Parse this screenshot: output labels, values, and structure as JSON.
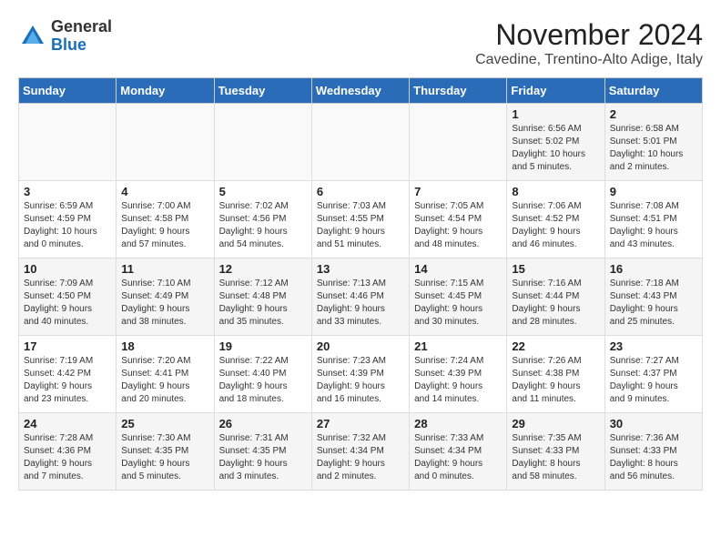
{
  "header": {
    "logo": {
      "general": "General",
      "blue": "Blue"
    },
    "title": "November 2024",
    "location": "Cavedine, Trentino-Alto Adige, Italy"
  },
  "weekdays": [
    "Sunday",
    "Monday",
    "Tuesday",
    "Wednesday",
    "Thursday",
    "Friday",
    "Saturday"
  ],
  "weeks": [
    [
      {
        "day": "",
        "info": ""
      },
      {
        "day": "",
        "info": ""
      },
      {
        "day": "",
        "info": ""
      },
      {
        "day": "",
        "info": ""
      },
      {
        "day": "",
        "info": ""
      },
      {
        "day": "1",
        "info": "Sunrise: 6:56 AM\nSunset: 5:02 PM\nDaylight: 10 hours\nand 5 minutes."
      },
      {
        "day": "2",
        "info": "Sunrise: 6:58 AM\nSunset: 5:01 PM\nDaylight: 10 hours\nand 2 minutes."
      }
    ],
    [
      {
        "day": "3",
        "info": "Sunrise: 6:59 AM\nSunset: 4:59 PM\nDaylight: 10 hours\nand 0 minutes."
      },
      {
        "day": "4",
        "info": "Sunrise: 7:00 AM\nSunset: 4:58 PM\nDaylight: 9 hours\nand 57 minutes."
      },
      {
        "day": "5",
        "info": "Sunrise: 7:02 AM\nSunset: 4:56 PM\nDaylight: 9 hours\nand 54 minutes."
      },
      {
        "day": "6",
        "info": "Sunrise: 7:03 AM\nSunset: 4:55 PM\nDaylight: 9 hours\nand 51 minutes."
      },
      {
        "day": "7",
        "info": "Sunrise: 7:05 AM\nSunset: 4:54 PM\nDaylight: 9 hours\nand 48 minutes."
      },
      {
        "day": "8",
        "info": "Sunrise: 7:06 AM\nSunset: 4:52 PM\nDaylight: 9 hours\nand 46 minutes."
      },
      {
        "day": "9",
        "info": "Sunrise: 7:08 AM\nSunset: 4:51 PM\nDaylight: 9 hours\nand 43 minutes."
      }
    ],
    [
      {
        "day": "10",
        "info": "Sunrise: 7:09 AM\nSunset: 4:50 PM\nDaylight: 9 hours\nand 40 minutes."
      },
      {
        "day": "11",
        "info": "Sunrise: 7:10 AM\nSunset: 4:49 PM\nDaylight: 9 hours\nand 38 minutes."
      },
      {
        "day": "12",
        "info": "Sunrise: 7:12 AM\nSunset: 4:48 PM\nDaylight: 9 hours\nand 35 minutes."
      },
      {
        "day": "13",
        "info": "Sunrise: 7:13 AM\nSunset: 4:46 PM\nDaylight: 9 hours\nand 33 minutes."
      },
      {
        "day": "14",
        "info": "Sunrise: 7:15 AM\nSunset: 4:45 PM\nDaylight: 9 hours\nand 30 minutes."
      },
      {
        "day": "15",
        "info": "Sunrise: 7:16 AM\nSunset: 4:44 PM\nDaylight: 9 hours\nand 28 minutes."
      },
      {
        "day": "16",
        "info": "Sunrise: 7:18 AM\nSunset: 4:43 PM\nDaylight: 9 hours\nand 25 minutes."
      }
    ],
    [
      {
        "day": "17",
        "info": "Sunrise: 7:19 AM\nSunset: 4:42 PM\nDaylight: 9 hours\nand 23 minutes."
      },
      {
        "day": "18",
        "info": "Sunrise: 7:20 AM\nSunset: 4:41 PM\nDaylight: 9 hours\nand 20 minutes."
      },
      {
        "day": "19",
        "info": "Sunrise: 7:22 AM\nSunset: 4:40 PM\nDaylight: 9 hours\nand 18 minutes."
      },
      {
        "day": "20",
        "info": "Sunrise: 7:23 AM\nSunset: 4:39 PM\nDaylight: 9 hours\nand 16 minutes."
      },
      {
        "day": "21",
        "info": "Sunrise: 7:24 AM\nSunset: 4:39 PM\nDaylight: 9 hours\nand 14 minutes."
      },
      {
        "day": "22",
        "info": "Sunrise: 7:26 AM\nSunset: 4:38 PM\nDaylight: 9 hours\nand 11 minutes."
      },
      {
        "day": "23",
        "info": "Sunrise: 7:27 AM\nSunset: 4:37 PM\nDaylight: 9 hours\nand 9 minutes."
      }
    ],
    [
      {
        "day": "24",
        "info": "Sunrise: 7:28 AM\nSunset: 4:36 PM\nDaylight: 9 hours\nand 7 minutes."
      },
      {
        "day": "25",
        "info": "Sunrise: 7:30 AM\nSunset: 4:35 PM\nDaylight: 9 hours\nand 5 minutes."
      },
      {
        "day": "26",
        "info": "Sunrise: 7:31 AM\nSunset: 4:35 PM\nDaylight: 9 hours\nand 3 minutes."
      },
      {
        "day": "27",
        "info": "Sunrise: 7:32 AM\nSunset: 4:34 PM\nDaylight: 9 hours\nand 2 minutes."
      },
      {
        "day": "28",
        "info": "Sunrise: 7:33 AM\nSunset: 4:34 PM\nDaylight: 9 hours\nand 0 minutes."
      },
      {
        "day": "29",
        "info": "Sunrise: 7:35 AM\nSunset: 4:33 PM\nDaylight: 8 hours\nand 58 minutes."
      },
      {
        "day": "30",
        "info": "Sunrise: 7:36 AM\nSunset: 4:33 PM\nDaylight: 8 hours\nand 56 minutes."
      }
    ]
  ]
}
